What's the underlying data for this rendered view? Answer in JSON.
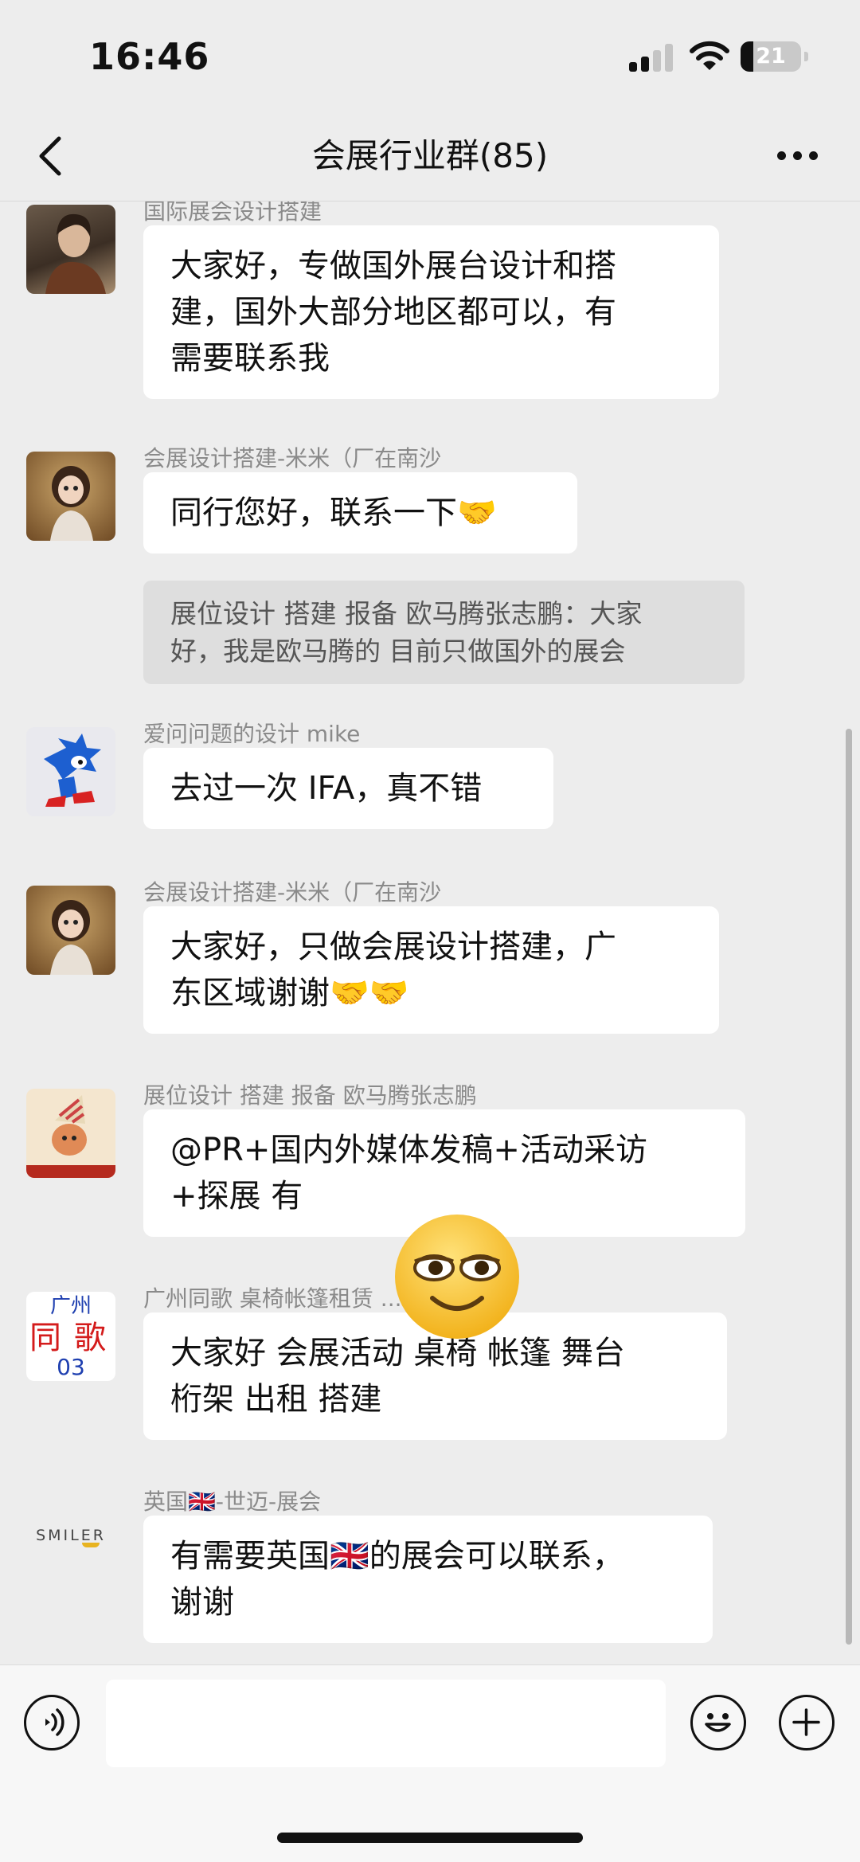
{
  "status_bar": {
    "time": "16:46",
    "battery": "21",
    "battery_level": 0.21
  },
  "header": {
    "title": "会展行业群(85)",
    "back_icon": "chevron-left-icon",
    "more_icon": "more-dots-icon"
  },
  "messages": [
    {
      "sender": "国际展会设计搭建",
      "lines": [
        "大家好，专做国外展台设计和搭",
        "建，国外大部分地区都可以，有",
        "需要联系我"
      ]
    },
    {
      "sender": "会展设计搭建-米米（厂在南沙",
      "lines": [
        "同行您好，联系一下🤝"
      ],
      "quote": [
        "展位设计 搭建 报备 欧马腾张志鹏：大家",
        "好，我是欧马腾的 目前只做国外的展会"
      ]
    },
    {
      "sender": "爱问问题的设计 mike",
      "lines": [
        "去过一次 IFA，真不错"
      ]
    },
    {
      "sender": "会展设计搭建-米米（厂在南沙",
      "lines": [
        "大家好，只做会展设计搭建，广",
        "东区域谢谢🤝🤝"
      ]
    },
    {
      "sender": "展位设计 搭建 报备 欧马腾张志鹏",
      "lines": [
        "@PR+国内外媒体发稿+活动采访",
        "+探展 有"
      ]
    },
    {
      "sender": "广州同歌 桌椅帐篷租赁 ...610...",
      "lines": [
        "大家好 会展活动 桌椅 帐篷 舞台",
        "桁架 出租 搭建"
      ],
      "avatar_text": [
        "广州",
        "同",
        "歌",
        "03"
      ]
    },
    {
      "sender": "英国🇬🇧-世迈-展会",
      "lines": [
        "有需要英国🇬🇧的展会可以联系，",
        "谢谢"
      ],
      "avatar_text": [
        "SMILER"
      ]
    }
  ],
  "input_bar": {
    "voice_icon": "voice-icon",
    "emoji_icon": "emoji-icon",
    "plus_icon": "plus-icon"
  },
  "colors": {
    "background": "#ededed",
    "bubble": "#ffffff",
    "quote": "#dedede",
    "sender": "#8a8a8a"
  }
}
